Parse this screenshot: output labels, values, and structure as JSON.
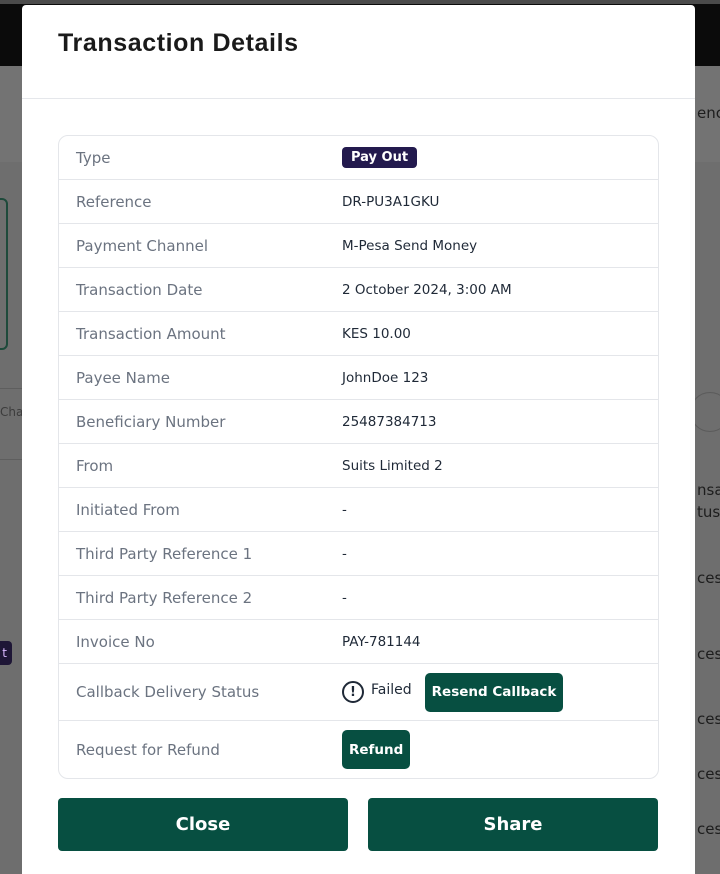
{
  "background": {
    "left_text": "Cha",
    "left_badge": "t",
    "right_texts": [
      "enc",
      "nsa",
      "tus",
      "ces",
      "ces",
      "ces",
      "ces",
      "ces"
    ]
  },
  "modal": {
    "title": "Transaction Details",
    "rows": [
      {
        "label": "Type",
        "value": "Pay Out"
      },
      {
        "label": "Reference",
        "value": "DR-PU3A1GKU"
      },
      {
        "label": "Payment Channel",
        "value": "M-Pesa Send Money"
      },
      {
        "label": "Transaction Date",
        "value": "2 October 2024, 3:00 AM"
      },
      {
        "label": "Transaction Amount",
        "value": "KES 10.00"
      },
      {
        "label": "Payee Name",
        "value": "JohnDoe 123"
      },
      {
        "label": "Beneficiary Number",
        "value": "25487384713"
      },
      {
        "label": "From",
        "value": "Suits Limited 2"
      },
      {
        "label": "Initiated From",
        "value": "-"
      },
      {
        "label": "Third Party Reference 1",
        "value": "-"
      },
      {
        "label": "Third Party Reference 2",
        "value": "-"
      },
      {
        "label": "Invoice No",
        "value": "PAY-781144"
      },
      {
        "label": "Callback Delivery Status",
        "status": "Failed",
        "action": "Resend Callback"
      },
      {
        "label": "Request for Refund",
        "action": "Refund"
      }
    ],
    "status_icon_glyph": "!",
    "close_label": "Close",
    "share_label": "Share"
  },
  "colors": {
    "primary_button": "#074f41",
    "payout_badge": "#231a4e"
  }
}
